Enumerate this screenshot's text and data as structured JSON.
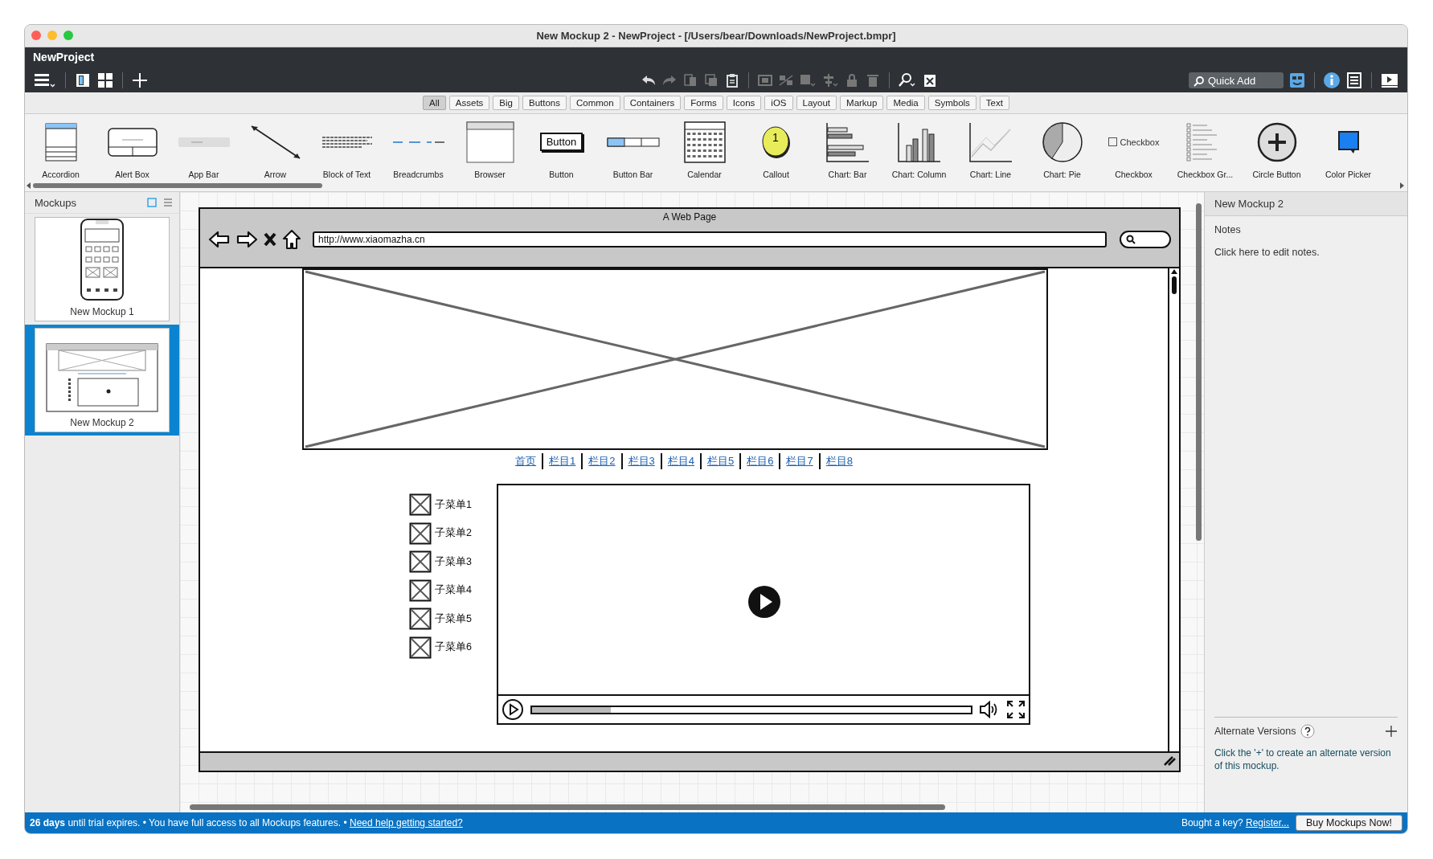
{
  "window": {
    "title": "New Mockup 2 - NewProject - [/Users/bear/Downloads/NewProject.bmpr]"
  },
  "app": {
    "project_name": "NewProject",
    "quick_add": {
      "placeholder": "Quick Add"
    }
  },
  "filter_tabs": [
    {
      "label": "All",
      "selected": true
    },
    {
      "label": "Assets",
      "selected": false
    },
    {
      "label": "Big",
      "selected": false
    },
    {
      "label": "Buttons",
      "selected": false
    },
    {
      "label": "Common",
      "selected": false
    },
    {
      "label": "Containers",
      "selected": false
    },
    {
      "label": "Forms",
      "selected": false
    },
    {
      "label": "Icons",
      "selected": false
    },
    {
      "label": "iOS",
      "selected": false
    },
    {
      "label": "Layout",
      "selected": false
    },
    {
      "label": "Markup",
      "selected": false
    },
    {
      "label": "Media",
      "selected": false
    },
    {
      "label": "Symbols",
      "selected": false
    },
    {
      "label": "Text",
      "selected": false
    }
  ],
  "library": [
    {
      "label": "Accordion"
    },
    {
      "label": "Alert Box"
    },
    {
      "label": "App Bar"
    },
    {
      "label": "Arrow"
    },
    {
      "label": "Block of Text"
    },
    {
      "label": "Breadcrumbs"
    },
    {
      "label": "Browser"
    },
    {
      "label": "Button",
      "preview": "Button"
    },
    {
      "label": "Button Bar"
    },
    {
      "label": "Calendar"
    },
    {
      "label": "Callout",
      "preview": "1"
    },
    {
      "label": "Chart: Bar"
    },
    {
      "label": "Chart: Column"
    },
    {
      "label": "Chart: Line"
    },
    {
      "label": "Chart: Pie"
    },
    {
      "label": "Checkbox",
      "preview": "Checkbox"
    },
    {
      "label": "Checkbox Gr..."
    },
    {
      "label": "Circle Button"
    },
    {
      "label": "Color Picker"
    }
  ],
  "mockups_panel": {
    "title": "Mockups",
    "items": [
      {
        "label": "New Mockup 1",
        "selected": false
      },
      {
        "label": "New Mockup 2",
        "selected": true
      }
    ]
  },
  "mockup": {
    "title": "A Web Page",
    "url": "http://www.xiaomazha.cn",
    "nav_links": [
      "首页",
      "栏目1",
      "栏目2",
      "栏目3",
      "栏目4",
      "栏目5",
      "栏目6",
      "栏目7",
      "栏目8"
    ],
    "menu_items": [
      "子菜单1",
      "子菜单2",
      "子菜单3",
      "子菜单4",
      "子菜单5",
      "子菜单6"
    ],
    "video": {
      "level": 0.18
    }
  },
  "properties": {
    "title": "New Mockup 2",
    "notes_label": "Notes",
    "notes_hint": "Click here to edit notes.",
    "alternate_versions": "Alternate Versions",
    "alternate_hint": "Click the '+' to create an alternate version of this mockup."
  },
  "status_bar": {
    "message": "**26 days** until trial expires. • You have full access to all Mockups features. •",
    "help_link": "Need help getting started?",
    "key_prompt": "Bought a key?",
    "register_link": "Register...",
    "buy_button": "Buy Mockups Now!"
  }
}
